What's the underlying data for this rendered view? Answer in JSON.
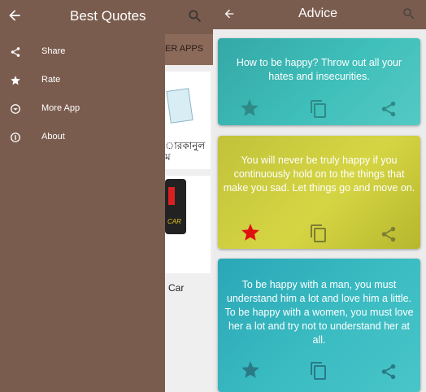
{
  "left_screen": {
    "appbar": {
      "title": "Best Quotes"
    },
    "background": {
      "tab_label": "ER APPS",
      "card1_text": "ারকানুল\nম",
      "card2_label": "Car",
      "thumb_label": "CAR"
    },
    "drawer": {
      "items": [
        {
          "label": "Share",
          "icon": "share-icon"
        },
        {
          "label": "Rate",
          "icon": "star-icon"
        },
        {
          "label": "More App",
          "icon": "chevron-circle-icon"
        },
        {
          "label": "About",
          "icon": "info-icon"
        }
      ]
    }
  },
  "right_screen": {
    "appbar": {
      "title": "Advice"
    },
    "cards": [
      {
        "text": "How to be happy? Throw out all your hates and insecurities.",
        "favorited": false
      },
      {
        "text": "You will never be truly happy if you continuously hold on to the things that make you sad. Let things go and move on.",
        "favorited": true
      },
      {
        "text": "To be happy with a man, you must understand him a lot and love him a little. To be happy with a women, you must love her a lot and try not to understand her at all.",
        "favorited": false
      }
    ]
  },
  "colors": {
    "appbar": "#7a5c4e",
    "card_teal": "#3fbfba",
    "card_olive": "#d5d544",
    "favorite_red": "#e01010"
  }
}
